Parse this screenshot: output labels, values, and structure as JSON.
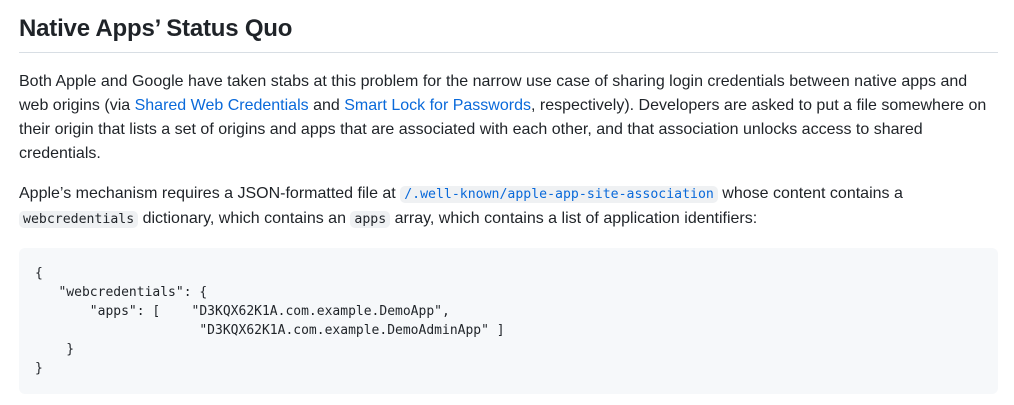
{
  "heading": "Native Apps’ Status Quo",
  "para1": {
    "t1": "Both Apple and Google have taken stabs at this problem for the narrow use case of sharing login credentials between native apps and web origins (via ",
    "link1": "Shared Web Credentials",
    "t2": " and ",
    "link2": "Smart Lock for Passwords",
    "t3": ", respectively). Developers are asked to put a file somewhere on their origin that lists a set of origins and apps that are associated with each other, and that association unlocks access to shared credentials."
  },
  "para2": {
    "t1": "Apple’s mechanism requires a JSON-formatted file at ",
    "code1": "/.well-known/apple-app-site-association",
    "t2": " whose content contains a ",
    "code2": "webcredentials",
    "t3": " dictionary, which contains an ",
    "code3": "apps",
    "t4": " array, which contains a list of application identifiers:"
  },
  "code_block": "{\n   \"webcredentials\": {\n       \"apps\": [    \"D3KQX62K1A.com.example.DemoApp\",\n                     \"D3KQX62K1A.com.example.DemoAdminApp\" ]\n    }\n}"
}
